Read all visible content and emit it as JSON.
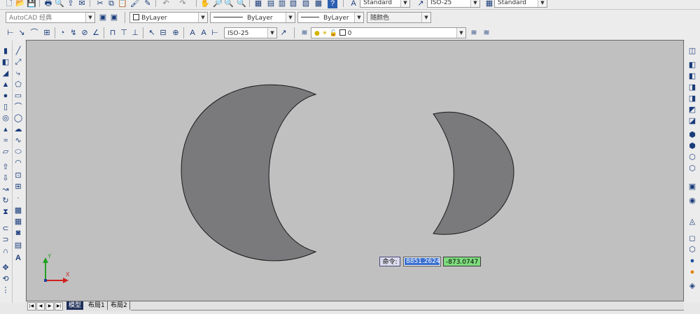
{
  "toolbar_top": {
    "text_style_value": "Standard",
    "dim_style_value": "ISO-25",
    "table_style_value": "Standard"
  },
  "toolbar_props": {
    "workspace_value": "AutoCAD 经典",
    "color_value": "ByLayer",
    "linetype_value": "ByLayer",
    "lineweight_value": "ByLayer",
    "plotstyle_value": "随颜色"
  },
  "toolbar_dim": {
    "dim_style_value": "ISO-25",
    "layer_value": "0"
  },
  "layout_tabs": {
    "model": "模型",
    "layout1": "布局1",
    "layout2": "布局2"
  },
  "dynamic_input": {
    "prompt": "命令:",
    "x_value": "8851.2624",
    "y_value": "-873.0747"
  },
  "ucs": {
    "x_label": "X",
    "y_label": "Y"
  },
  "colors": {
    "canvas_bg": "#c0c0c0",
    "shape_fill": "#7a797c",
    "shape_stroke": "#1a1a1a",
    "selection": "#3a6fd0",
    "coord_green": "#7ddc7d"
  }
}
